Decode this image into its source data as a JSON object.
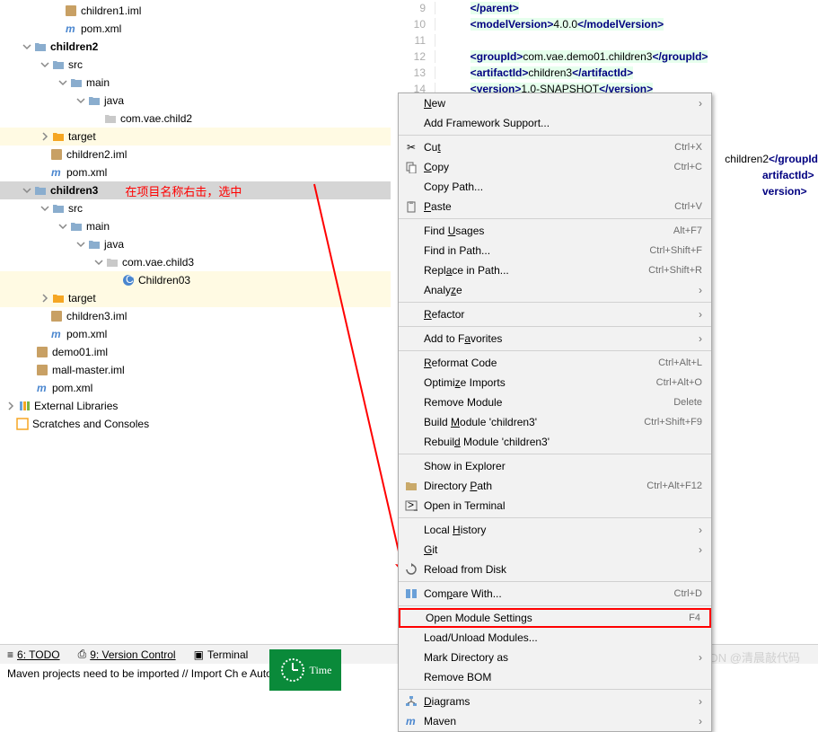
{
  "tree": {
    "n0": "children1.iml",
    "n1": "pom.xml",
    "n2": "children2",
    "n3": "src",
    "n4": "main",
    "n5": "java",
    "n6": "com.vae.child2",
    "n7": "target",
    "n8": "children2.iml",
    "n9": "pom.xml",
    "n10": "children3",
    "n11": "src",
    "n12": "main",
    "n13": "java",
    "n14": "com.vae.child3",
    "n15": "Children03",
    "n16": "target",
    "n17": "children3.iml",
    "n18": "pom.xml",
    "n19": "demo01.iml",
    "n20": "mall-master.iml",
    "n21": "pom.xml",
    "n22": "External Libraries",
    "n23": "Scratches and Consoles"
  },
  "annotation": "在项目名称右击，选中",
  "editor": {
    "lines": [
      {
        "num": "9",
        "parts": [
          {
            "t": "</",
            "c": "tag"
          },
          {
            "t": "parent",
            "c": "tag"
          },
          {
            "t": ">",
            "c": "tag"
          }
        ]
      },
      {
        "num": "10",
        "parts": [
          {
            "t": "<",
            "c": "tag"
          },
          {
            "t": "modelVersion",
            "c": "tag"
          },
          {
            "t": ">",
            "c": "tag"
          },
          {
            "t": "4.0.0",
            "c": "text"
          },
          {
            "t": "</",
            "c": "tag"
          },
          {
            "t": "modelVersion",
            "c": "tag"
          },
          {
            "t": ">",
            "c": "tag"
          }
        ]
      },
      {
        "num": "11",
        "parts": []
      },
      {
        "num": "12",
        "parts": [
          {
            "t": "<",
            "c": "tag"
          },
          {
            "t": "groupId",
            "c": "tag"
          },
          {
            "t": ">",
            "c": "tag"
          },
          {
            "t": "com.vae.demo01.children3",
            "c": "text"
          },
          {
            "t": "</",
            "c": "tag"
          },
          {
            "t": "groupId",
            "c": "tag"
          },
          {
            "t": ">",
            "c": "tag"
          }
        ]
      },
      {
        "num": "13",
        "parts": [
          {
            "t": "<",
            "c": "tag"
          },
          {
            "t": "artifactId",
            "c": "tag"
          },
          {
            "t": ">",
            "c": "tag"
          },
          {
            "t": "children3",
            "c": "text"
          },
          {
            "t": "</",
            "c": "tag"
          },
          {
            "t": "artifactId",
            "c": "tag"
          },
          {
            "t": ">",
            "c": "tag"
          }
        ]
      },
      {
        "num": "14",
        "parts": [
          {
            "t": "<",
            "c": "tag"
          },
          {
            "t": "version",
            "c": "tag"
          },
          {
            "t": ">",
            "c": "tag"
          },
          {
            "t": "1.0-SNAPSHOT",
            "c": "text"
          },
          {
            "t": "</",
            "c": "tag"
          },
          {
            "t": "version",
            "c": "tag"
          },
          {
            "t": ">",
            "c": "tag"
          }
        ]
      }
    ],
    "frag1": "children2",
    "frag2": "</groupId",
    "frag3": "artifactId>",
    "frag4": "version>"
  },
  "menu": {
    "new": "New",
    "afs": "Add Framework Support...",
    "cut": "Cut",
    "cut_sc": "Ctrl+X",
    "copy": "Copy",
    "copy_sc": "Ctrl+C",
    "copy_path": "Copy Path...",
    "paste": "Paste",
    "paste_sc": "Ctrl+V",
    "find_usages": "Find Usages",
    "find_usages_sc": "Alt+F7",
    "find_in_path": "Find in Path...",
    "find_in_path_sc": "Ctrl+Shift+F",
    "replace_in_path": "Replace in Path...",
    "replace_in_path_sc": "Ctrl+Shift+R",
    "analyze": "Analyze",
    "refactor": "Refactor",
    "add_fav": "Add to Favorites",
    "reformat": "Reformat Code",
    "reformat_sc": "Ctrl+Alt+L",
    "optimize": "Optimize Imports",
    "optimize_sc": "Ctrl+Alt+O",
    "remove_module": "Remove Module",
    "remove_module_sc": "Delete",
    "build": "Build Module 'children3'",
    "build_sc": "Ctrl+Shift+F9",
    "rebuild": "Rebuild Module 'children3'",
    "show_explorer": "Show in Explorer",
    "dir_path": "Directory Path",
    "dir_path_sc": "Ctrl+Alt+F12",
    "open_terminal": "Open in Terminal",
    "local_history": "Local History",
    "git": "Git",
    "reload": "Reload from Disk",
    "compare": "Compare With...",
    "compare_sc": "Ctrl+D",
    "open_module": "Open Module Settings",
    "open_module_sc": "F4",
    "load_unload": "Load/Unload Modules...",
    "mark_dir": "Mark Directory as",
    "remove_bom": "Remove BOM",
    "diagrams": "Diagrams",
    "maven": "Maven"
  },
  "bottombar": {
    "todo": "6: TODO",
    "vc": "9: Version Control",
    "terminal": "Terminal"
  },
  "statusbar": "Maven projects need to be imported // Import Ch            e Auto-Imp",
  "clock": "Time",
  "watermark": "CSDN @清晨敲代码"
}
